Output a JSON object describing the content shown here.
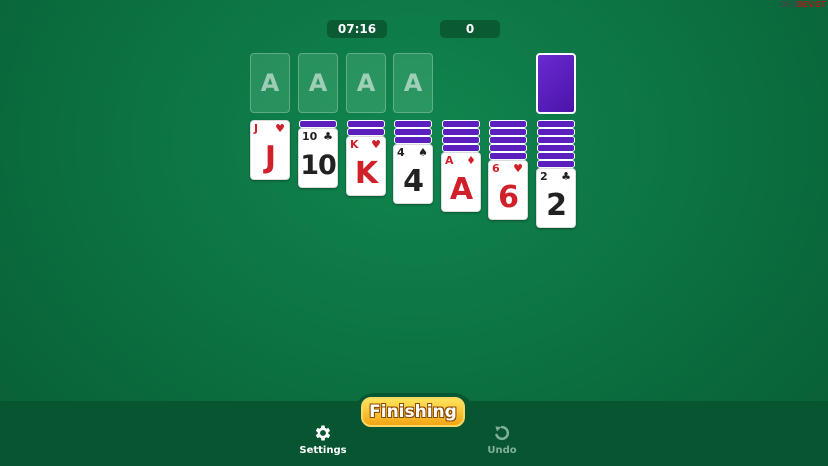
{
  "header": {
    "timer": "07:16",
    "score": "0"
  },
  "watermark": {
    "line1": "DEV",
    "line2": "DEV.GT"
  },
  "foundations": [
    "A",
    "A",
    "A",
    "A"
  ],
  "tableau": [
    {
      "facedown": 0,
      "rank": "J",
      "suit": "♥",
      "color": "red"
    },
    {
      "facedown": 1,
      "rank": "10",
      "suit": "♣",
      "color": "black"
    },
    {
      "facedown": 2,
      "rank": "K",
      "suit": "♥",
      "color": "red"
    },
    {
      "facedown": 3,
      "rank": "4",
      "suit": "♠",
      "color": "black"
    },
    {
      "facedown": 4,
      "rank": "A",
      "suit": "♦",
      "color": "red"
    },
    {
      "facedown": 5,
      "rank": "6",
      "suit": "♥",
      "color": "red"
    },
    {
      "facedown": 6,
      "rank": "2",
      "suit": "♣",
      "color": "black"
    }
  ],
  "actions": {
    "finish_label": "Finishing",
    "settings_label": "Settings",
    "undo_label": "Undo"
  },
  "icons": {
    "settings": "gear-icon",
    "undo": "undo-icon"
  },
  "colors": {
    "felt": "#0c7443",
    "card_back": "#5a1fbc",
    "finish_button": "#f3a513"
  }
}
